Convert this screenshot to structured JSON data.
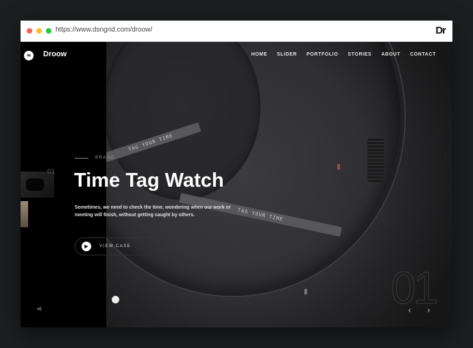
{
  "browser": {
    "url": "https://www.dsngrid.com/droow/",
    "brand_mark": "Dr"
  },
  "site": {
    "logo": "Droow",
    "nav": [
      "HOME",
      "SLIDER",
      "PORTFOLIO",
      "STORIES",
      "ABOUT",
      "CONTACT"
    ]
  },
  "hero": {
    "tag": "BRAND",
    "title": "Time Tag Watch",
    "description": "Sometimes, we need to check the time, wondering when our work or meeting will finish, without getting caught by others.",
    "cta": "VIEW CASE",
    "watch_text_1": "TAG YOUR TIME",
    "watch_text_2": "TAG YOUR TIME"
  },
  "slider": {
    "thumb_number": "01",
    "current_number": "01",
    "prev_icon": "chevron-left-icon",
    "next_icon": "chevron-right-icon"
  },
  "icons": {
    "menu": "menu-icon",
    "play": "play-icon",
    "share": "share-icon"
  }
}
